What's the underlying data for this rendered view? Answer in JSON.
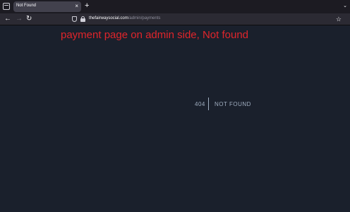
{
  "browser": {
    "tab": {
      "title": "Not Found",
      "close_glyph": "×"
    },
    "new_tab_glyph": "+",
    "overflow_glyph": "⌄",
    "nav": {
      "back_glyph": "←",
      "forward_glyph": "→",
      "reload_glyph": "↻"
    },
    "url": {
      "host": "thefairwaysocial.com",
      "path": "/admin/payments"
    },
    "bookmark_glyph": "☆",
    "icons": [
      "tab-list-icon",
      "close-icon",
      "new-tab-icon",
      "chevron-down-icon",
      "back-arrow-icon",
      "forward-arrow-icon",
      "reload-icon",
      "shield-icon",
      "lock-icon",
      "star-icon"
    ]
  },
  "annotation": {
    "text": "payment page on admin side, Not found",
    "color": "#e0252b"
  },
  "error": {
    "code": "404",
    "message": "NOT FOUND"
  },
  "colors": {
    "page_background": "#1a202c",
    "error_text": "#a0aec0",
    "tab_active": "#42414d",
    "toolbar": "#2b2a33"
  }
}
